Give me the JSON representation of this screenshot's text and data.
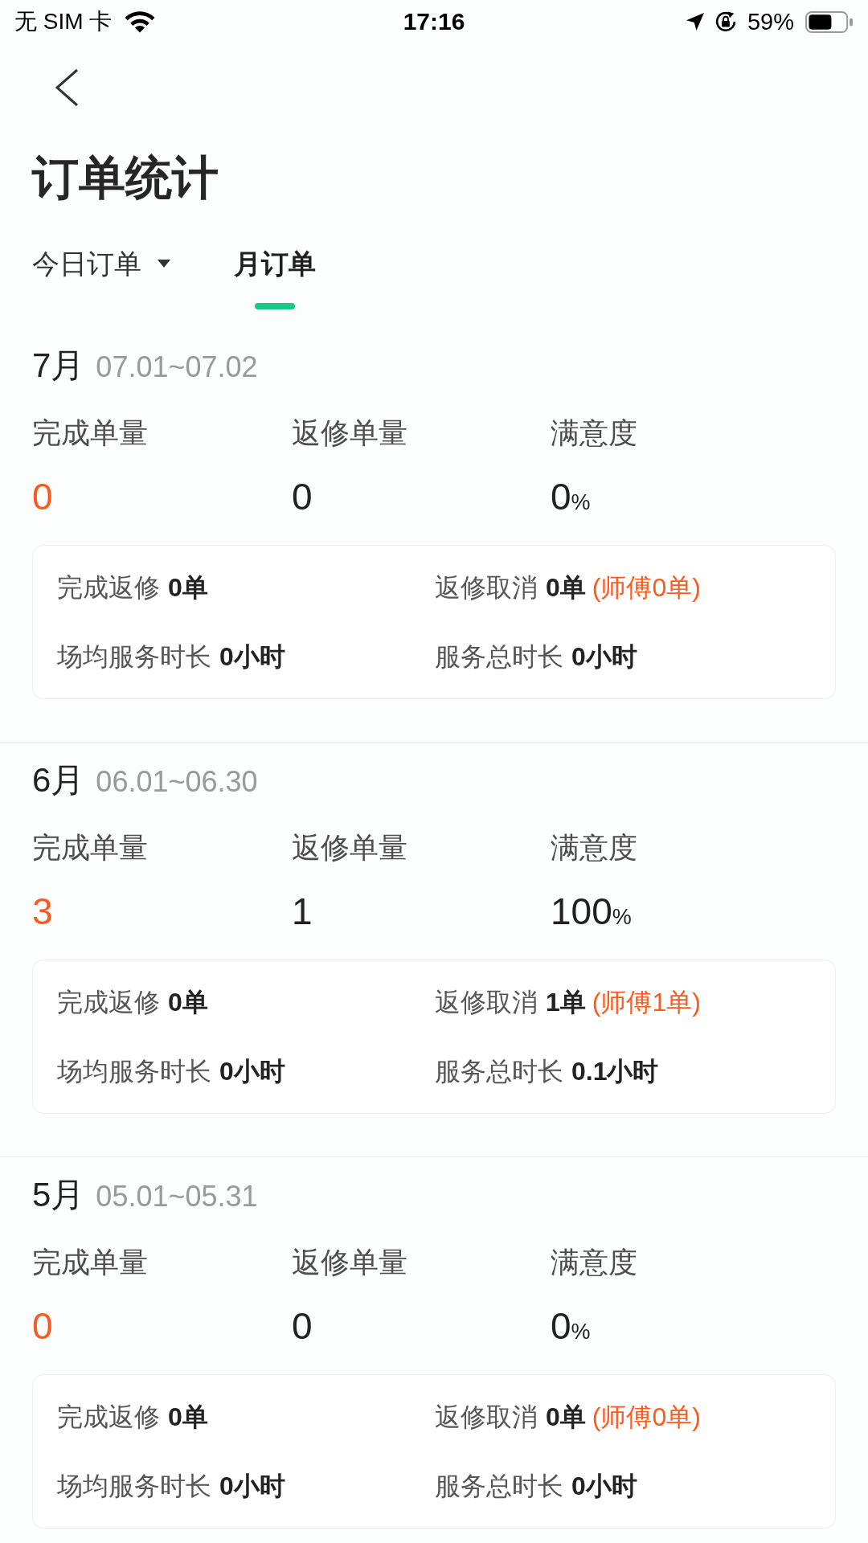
{
  "status_bar": {
    "carrier": "无 SIM 卡",
    "time": "17:16",
    "battery": "59%"
  },
  "header": {
    "title": "订单统计"
  },
  "tabs": [
    {
      "label": "今日订单",
      "selected": false,
      "dropdown": true
    },
    {
      "label": "月订单",
      "selected": true,
      "dropdown": false
    }
  ],
  "months": [
    {
      "month": "7月",
      "range": "07.01~07.02",
      "stats": [
        {
          "label": "完成单量",
          "value": "0",
          "color": "#fa5a22"
        },
        {
          "label": "返修单量",
          "value": "0",
          "color": "#222222"
        },
        {
          "label": "满意度",
          "value": "0",
          "unit": "%",
          "color": "#222222"
        }
      ],
      "details": [
        {
          "label": "完成返修",
          "value": "0单"
        },
        {
          "label": "返修取消",
          "value": "0单",
          "note": "(师傅0单)"
        },
        {
          "label": "场均服务时长",
          "value": "0小时"
        },
        {
          "label": "服务总时长",
          "value": "0小时"
        }
      ]
    },
    {
      "month": "6月",
      "range": "06.01~06.30",
      "stats": [
        {
          "label": "完成单量",
          "value": "3",
          "color": "#fa5a22"
        },
        {
          "label": "返修单量",
          "value": "1",
          "color": "#222222"
        },
        {
          "label": "满意度",
          "value": "100",
          "unit": "%",
          "color": "#222222"
        }
      ],
      "details": [
        {
          "label": "完成返修",
          "value": "0单"
        },
        {
          "label": "返修取消",
          "value": "1单",
          "note": "(师傅1单)"
        },
        {
          "label": "场均服务时长",
          "value": "0小时"
        },
        {
          "label": "服务总时长",
          "value": "0.1小时"
        }
      ]
    },
    {
      "month": "5月",
      "range": "05.01~05.31",
      "stats": [
        {
          "label": "完成单量",
          "value": "0",
          "color": "#fa5a22"
        },
        {
          "label": "返修单量",
          "value": "0",
          "color": "#222222"
        },
        {
          "label": "满意度",
          "value": "0",
          "unit": "%",
          "color": "#222222"
        }
      ],
      "details": [
        {
          "label": "完成返修",
          "value": "0单"
        },
        {
          "label": "返修取消",
          "value": "0单",
          "note": "(师傅0单)"
        },
        {
          "label": "场均服务时长",
          "value": "0小时"
        },
        {
          "label": "服务总时长",
          "value": "0小时"
        }
      ]
    }
  ]
}
